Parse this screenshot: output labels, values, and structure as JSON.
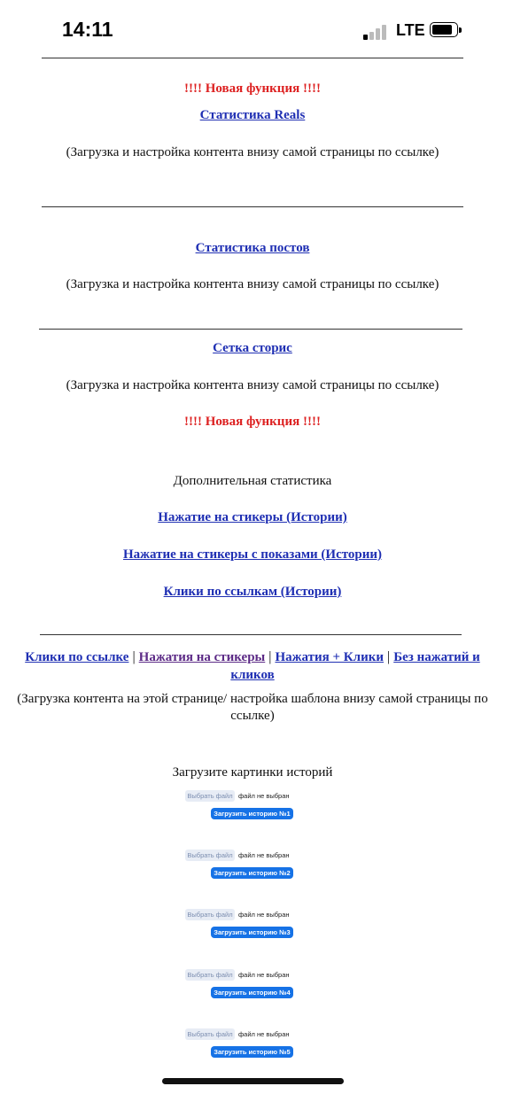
{
  "status_bar": {
    "time": "14:11",
    "network": "LTE"
  },
  "sections": {
    "new_feature_label": "!!!! Новая функция !!!!",
    "reels_link": "Статистика Reals",
    "note": "(Загрузка и настройка контента внизу самой страницы по ссылке)",
    "posts_link": "Статистика постов",
    "stories_grid_link": "Сетка сторис",
    "extra_stats_label": "Дополнительная статистика",
    "stickers_link": "Нажатие на стикеры (Истории)",
    "stickers_views_link": "Нажатие на стикеры с показами (Истории)",
    "link_clicks_link": "Клики по ссылкам (Истории)"
  },
  "template_nav": {
    "items": [
      "Клики по ссылке",
      "Нажатия на стикеры",
      "Нажатия + Клики",
      "Без нажатий и кликов"
    ],
    "separator": "|",
    "note": "(Загрузка контента на этой странице/ настройка шаблона внизу самой страницы по ссылке)"
  },
  "upload": {
    "title": "Загрузите картинки историй",
    "choose_label": "Выбрать файл",
    "no_file_label": "файл не выбран",
    "buttons": [
      "Загрузить историю №1",
      "Загрузить историю №2",
      "Загрузить историю №3",
      "Загрузить историю №4",
      "Загрузить историю №5"
    ]
  }
}
